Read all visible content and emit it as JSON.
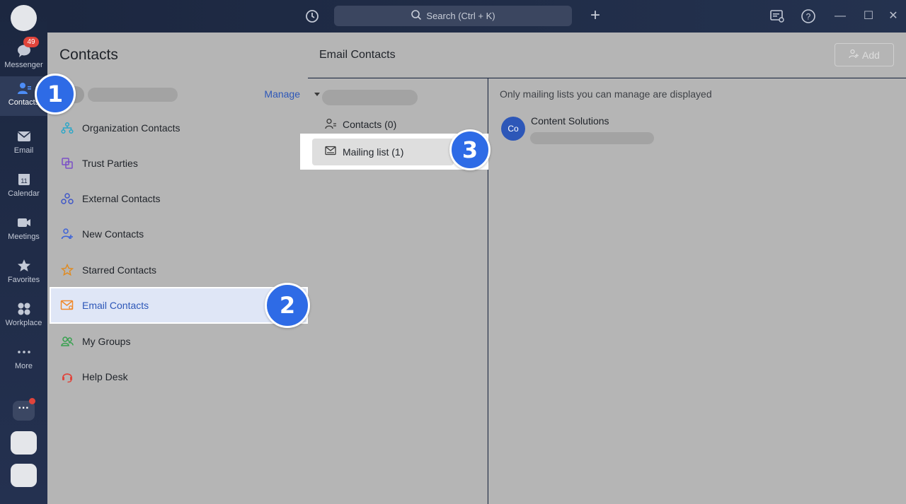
{
  "topbar": {
    "search_placeholder": "Search (Ctrl + K)",
    "icons": [
      "history-icon",
      "search-icon",
      "plus-icon",
      "announcement-icon",
      "help-icon",
      "minimize-icon",
      "maximize-icon",
      "close-icon"
    ]
  },
  "rail": {
    "items": [
      {
        "label": "Messenger",
        "icon": "messenger-icon",
        "badge": "49"
      },
      {
        "label": "Contacts",
        "icon": "contacts-icon",
        "active": true
      },
      {
        "label": "Email",
        "icon": "email-icon"
      },
      {
        "label": "Calendar",
        "icon": "calendar-icon",
        "day": "11"
      },
      {
        "label": "Meetings",
        "icon": "video-icon"
      },
      {
        "label": "Favorites",
        "icon": "star-icon"
      },
      {
        "label": "Workplace",
        "icon": "apps-icon"
      },
      {
        "label": "More",
        "icon": "more-icon"
      }
    ]
  },
  "contacts_panel": {
    "title": "Contacts",
    "manage_label": "Manage",
    "menu": [
      {
        "label": "Organization Contacts",
        "icon": "org-chart-icon",
        "color": "#2aa7c9"
      },
      {
        "label": "Trust Parties",
        "icon": "trust-parties-icon",
        "color": "#7b4fc7"
      },
      {
        "label": "External Contacts",
        "icon": "external-contacts-icon",
        "color": "#3f57c8"
      },
      {
        "label": "New Contacts",
        "icon": "add-person-icon",
        "color": "#3d63d8"
      },
      {
        "label": "Starred Contacts",
        "icon": "star-outline-icon",
        "color": "#e08a1e"
      },
      {
        "label": "Email Contacts",
        "icon": "email-contact-icon",
        "color": "#f08a2c",
        "selected": true
      },
      {
        "label": "My Groups",
        "icon": "groups-icon",
        "color": "#37a14f"
      },
      {
        "label": "Help Desk",
        "icon": "headset-icon",
        "color": "#e0443b"
      }
    ]
  },
  "email_contacts": {
    "title": "Email Contacts",
    "add_label": "Add",
    "tree": [
      {
        "label": "Contacts (0)",
        "icon": "person-list-icon"
      },
      {
        "label": "Mailing list (1)",
        "icon": "mail-list-icon",
        "selected": true
      }
    ],
    "notice": "Only mailing lists you can manage are displayed",
    "lists": [
      {
        "avatar_text": "Co",
        "name": "Content Solutions"
      }
    ]
  },
  "steps": [
    "1",
    "2",
    "3"
  ],
  "colors": {
    "accent": "#2e6be6",
    "link": "#2d57b8",
    "rail_bg": "#1c2740",
    "panel_overlay": "#b5b5b5",
    "badge": "#e0443b"
  }
}
